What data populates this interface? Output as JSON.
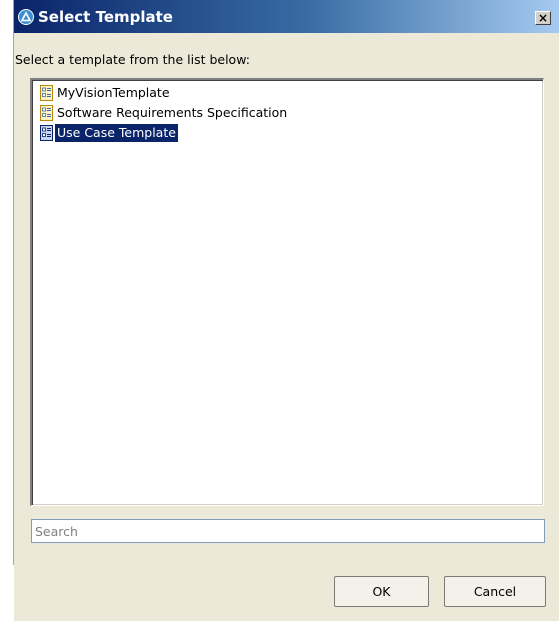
{
  "dialog": {
    "title": "Select Template",
    "close_label": "×",
    "instruction": "Select a template from the list below:"
  },
  "templates": [
    {
      "label": "MyVisionTemplate",
      "icon": "document-template-icon",
      "selected": false
    },
    {
      "label": "Software Requirements Specification",
      "icon": "document-template-icon",
      "selected": false
    },
    {
      "label": "Use Case Template",
      "icon": "document-template-icon",
      "selected": true
    }
  ],
  "search": {
    "placeholder": "Search",
    "value": ""
  },
  "buttons": {
    "ok_label": "OK",
    "cancel_label": "Cancel"
  },
  "colors": {
    "selection_bg": "#0a246a",
    "titlebar_start": "#0a246a",
    "dialog_bg": "#ece9d8"
  }
}
